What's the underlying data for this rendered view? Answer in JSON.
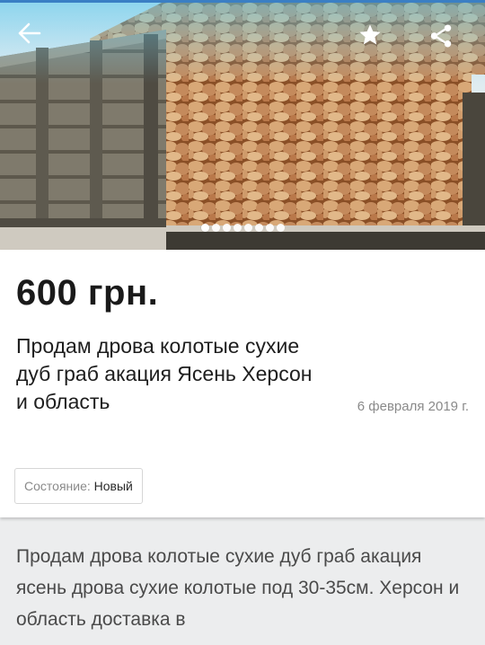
{
  "colors": {
    "accent": "#3a7fc4",
    "price": "#1a1a1a",
    "muted": "#8a8a8a",
    "background": "#ecedee"
  },
  "toolbar": {
    "back_icon": "arrow-left-icon",
    "favorite_icon": "star-icon",
    "share_icon": "share-icon"
  },
  "gallery": {
    "image": "truck loaded with split firewood",
    "photo_count": 8,
    "current_index": 0
  },
  "listing": {
    "price": "600 грн.",
    "title": "Продам дрова колотые сухие дуб граб акация Ясень Херсон и область",
    "date": "6 февраля 2019 г.",
    "condition_label": "Состояние:",
    "condition_value": "Новый",
    "description": "Продам дрова колотые сухие дуб граб акация ясень дрова сухие колотые под 30-35см. Херсон и область доставка в"
  }
}
